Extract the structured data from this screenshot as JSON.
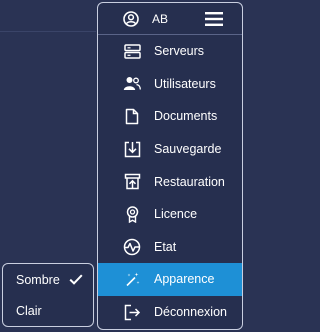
{
  "header": {
    "avatar_icon": "user-circle-icon",
    "initials": "AB",
    "menu_icon": "hamburger-icon"
  },
  "menu": {
    "items": [
      {
        "label": "Serveurs",
        "icon": "server-icon"
      },
      {
        "label": "Utilisateurs",
        "icon": "users-icon"
      },
      {
        "label": "Documents",
        "icon": "document-icon"
      },
      {
        "label": "Sauvegarde",
        "icon": "backup-download-icon"
      },
      {
        "label": "Restauration",
        "icon": "restore-upload-icon"
      },
      {
        "label": "Licence",
        "icon": "license-badge-icon"
      },
      {
        "label": "Etat",
        "icon": "heartbeat-icon"
      },
      {
        "label": "Apparence",
        "icon": "magic-wand-icon",
        "active": true
      },
      {
        "label": "Déconnexion",
        "icon": "logout-icon"
      }
    ]
  },
  "submenu": {
    "items": [
      {
        "label": "Sombre",
        "selected": true
      },
      {
        "label": "Clair",
        "selected": false
      }
    ],
    "check_icon": "checkmark-icon"
  },
  "colors": {
    "background": "#2a3354",
    "menu_bg": "#262f4f",
    "active": "#1e90d6",
    "border": "#c9cfe0",
    "text": "#ffffff"
  }
}
